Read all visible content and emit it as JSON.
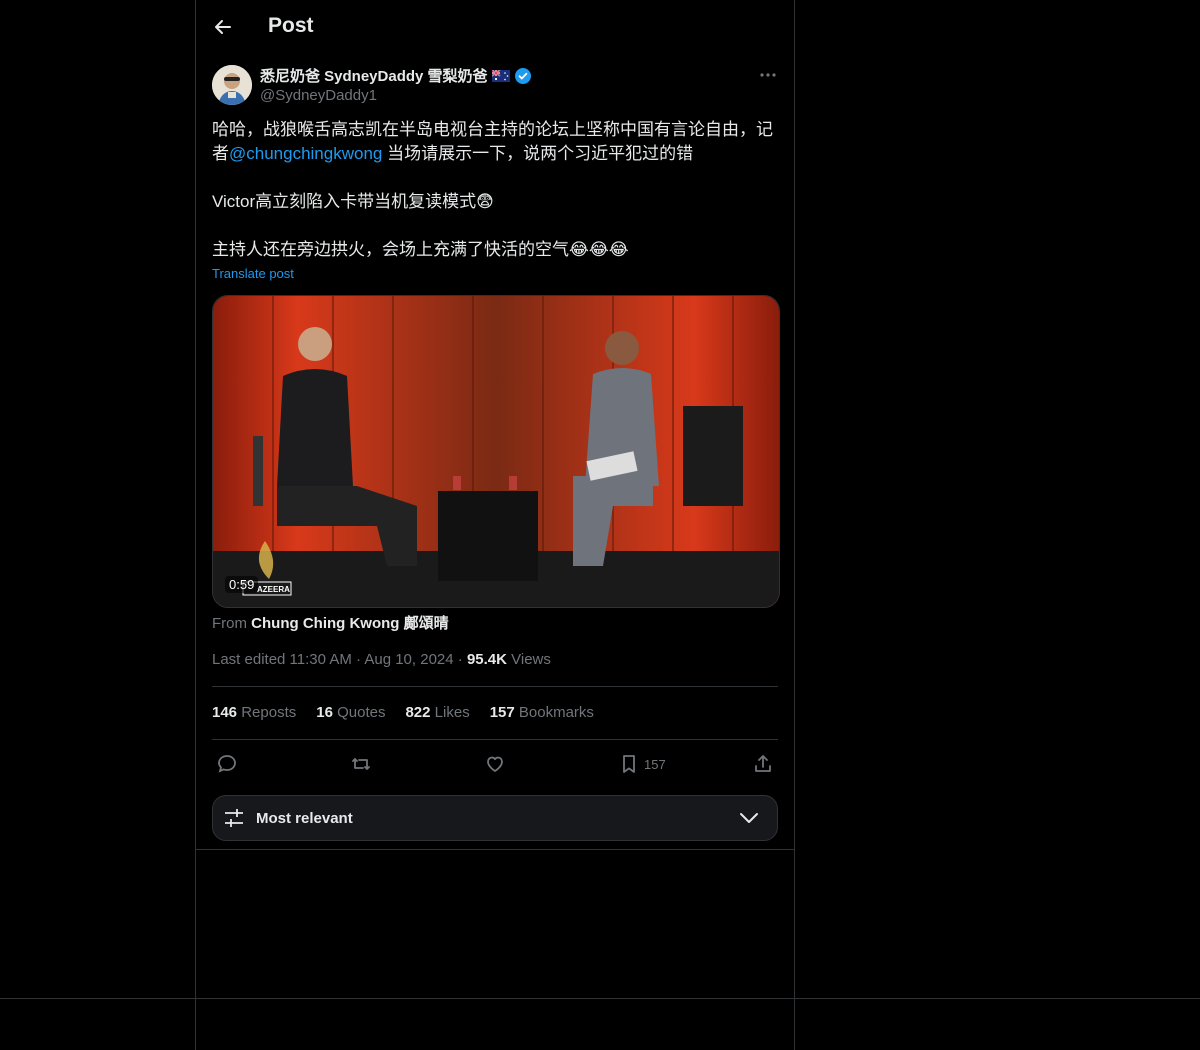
{
  "header": {
    "title": "Post"
  },
  "author": {
    "display_name": "悉尼奶爸 SydneyDaddy 雪梨奶爸",
    "handle": "@SydneyDaddy1"
  },
  "tweet": {
    "line1_pre": "哈哈，战狼喉舌高志凯在半岛电视台主持的论坛上坚称中国有言论自由，记者",
    "mention": "@chungchingkwong",
    "line1_post": " 当场请展示一下，说两个习近平犯过的错",
    "line2": "Victor高立刻陷入卡带当机复读模式😨",
    "line3": "主持人还在旁边拱火，会场上充满了快活的空气😂😂😂",
    "translate": "Translate post"
  },
  "media": {
    "duration": "0:59",
    "watermark": "AZEERA"
  },
  "from": {
    "prefix": "From",
    "source": "Chung Ching Kwong 鄺頌晴"
  },
  "meta": {
    "edited": "Last edited 11:30 AM",
    "date": "Aug 10, 2024",
    "views_count": "95.4K",
    "views_label": "Views"
  },
  "stats": {
    "reposts": "146",
    "reposts_label": "Reposts",
    "quotes": "16",
    "quotes_label": "Quotes",
    "likes": "822",
    "likes_label": "Likes",
    "bookmarks": "157",
    "bookmarks_label": "Bookmarks"
  },
  "actions": {
    "bookmark_count": "157"
  },
  "sort": {
    "label": "Most relevant"
  },
  "colors": {
    "accent": "#1d9bf0",
    "background": "#000000",
    "border": "#2f3336",
    "muted": "#71767b",
    "text": "#e7e9ea"
  }
}
